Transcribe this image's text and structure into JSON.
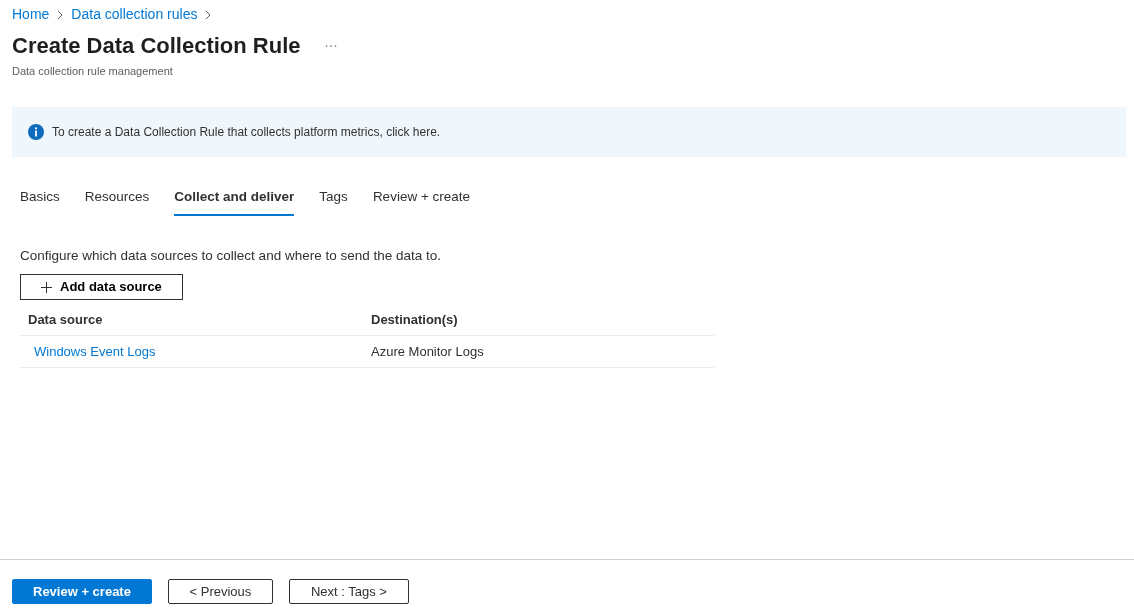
{
  "breadcrumb": [
    {
      "label": "Home"
    },
    {
      "label": "Data collection rules"
    }
  ],
  "title": "Create Data Collection Rule",
  "subtitle": "Data collection rule management",
  "info_banner": {
    "text": "To create a Data Collection Rule that collects platform metrics, click here."
  },
  "tabs": [
    {
      "label": "Basics",
      "selected": false
    },
    {
      "label": "Resources",
      "selected": false
    },
    {
      "label": "Collect and deliver",
      "selected": true
    },
    {
      "label": "Tags",
      "selected": false
    },
    {
      "label": "Review + create",
      "selected": false
    }
  ],
  "description": "Configure which data sources to collect and where to send the data to.",
  "add_button": "Add data source",
  "table": {
    "columns": [
      "Data source",
      "Destination(s)"
    ],
    "rows": [
      {
        "data_source": "Windows Event Logs",
        "destination": "Azure Monitor Logs"
      }
    ]
  },
  "footer_buttons": [
    {
      "label": "Review + create",
      "kind": "primary"
    },
    {
      "label": "< Previous",
      "kind": "secondary"
    },
    {
      "label": "Next : Tags >",
      "kind": "secondary"
    }
  ]
}
